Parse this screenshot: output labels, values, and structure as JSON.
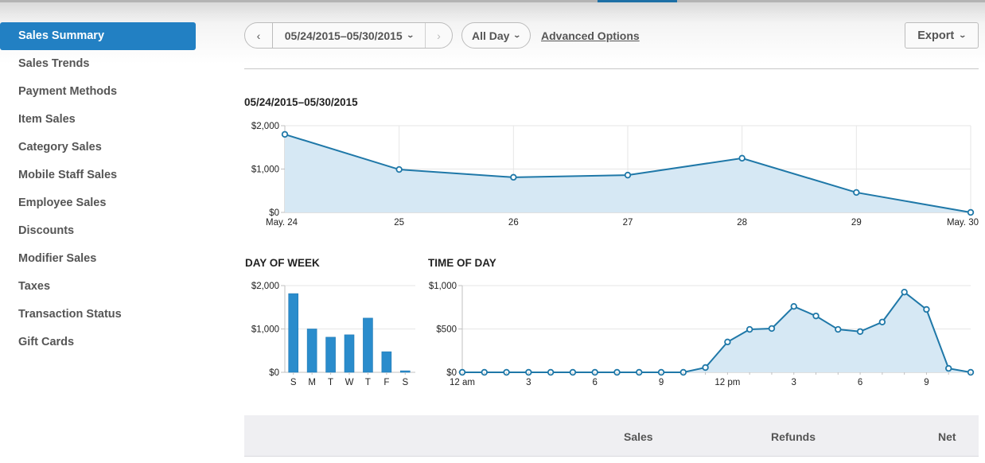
{
  "colors": {
    "accent": "#2280c3",
    "line": "#1f78a8",
    "fill": "#d6e8f4",
    "bar": "#2a8ccc"
  },
  "sidebar": {
    "items": [
      {
        "label": "Sales Summary",
        "active": true
      },
      {
        "label": "Sales Trends"
      },
      {
        "label": "Payment Methods"
      },
      {
        "label": "Item Sales"
      },
      {
        "label": "Category Sales"
      },
      {
        "label": "Mobile Staff Sales"
      },
      {
        "label": "Employee Sales"
      },
      {
        "label": "Discounts"
      },
      {
        "label": "Modifier Sales"
      },
      {
        "label": "Taxes"
      },
      {
        "label": "Transaction Status"
      },
      {
        "label": "Gift Cards"
      }
    ]
  },
  "toolbar": {
    "prev_icon": "‹",
    "next_icon": "›",
    "date_range": "05/24/2015–05/30/2015",
    "time_filter": "All Day",
    "advanced_options": "Advanced Options",
    "export_label": "Export",
    "chevron": "⌄"
  },
  "table": {
    "headers": [
      "",
      "Sales",
      "Refunds",
      "Net"
    ]
  },
  "chart_data": [
    {
      "id": "range",
      "type": "area",
      "title": "05/24/2015–05/30/2015",
      "x": [
        "May. 24",
        "25",
        "26",
        "27",
        "28",
        "29",
        "May. 30"
      ],
      "values": [
        1800,
        990,
        810,
        860,
        1250,
        460,
        0
      ],
      "yticks": [
        "$0",
        "$1,000",
        "$2,000"
      ],
      "ylim": [
        0,
        2000
      ],
      "grid": true
    },
    {
      "id": "dow",
      "type": "bar",
      "title": "DAY OF WEEK",
      "categories": [
        "S",
        "M",
        "T",
        "W",
        "T",
        "F",
        "S"
      ],
      "values": [
        1815,
        1000,
        810,
        865,
        1250,
        475,
        35
      ],
      "yticks": [
        "$0",
        "$1,000",
        "$2,000"
      ],
      "ylim": [
        0,
        2000
      ],
      "grid": true
    },
    {
      "id": "tod",
      "type": "area",
      "title": "TIME OF DAY",
      "hours": [
        0,
        1,
        2,
        3,
        4,
        5,
        6,
        7,
        8,
        9,
        10,
        11,
        12,
        13,
        14,
        15,
        16,
        17,
        18,
        19,
        20,
        21,
        22,
        23
      ],
      "values": [
        0,
        0,
        0,
        0,
        0,
        0,
        0,
        0,
        0,
        0,
        0,
        55,
        350,
        495,
        505,
        760,
        650,
        495,
        470,
        580,
        925,
        725,
        45,
        0
      ],
      "xtick_labels": [
        {
          "hour": 0,
          "label": "12 am"
        },
        {
          "hour": 3,
          "label": "3"
        },
        {
          "hour": 6,
          "label": "6"
        },
        {
          "hour": 9,
          "label": "9"
        },
        {
          "hour": 12,
          "label": "12 pm"
        },
        {
          "hour": 15,
          "label": "3"
        },
        {
          "hour": 18,
          "label": "6"
        },
        {
          "hour": 21,
          "label": "9"
        }
      ],
      "yticks": [
        "$0",
        "$500",
        "$1,000"
      ],
      "ylim": [
        0,
        1000
      ],
      "grid": true
    }
  ]
}
